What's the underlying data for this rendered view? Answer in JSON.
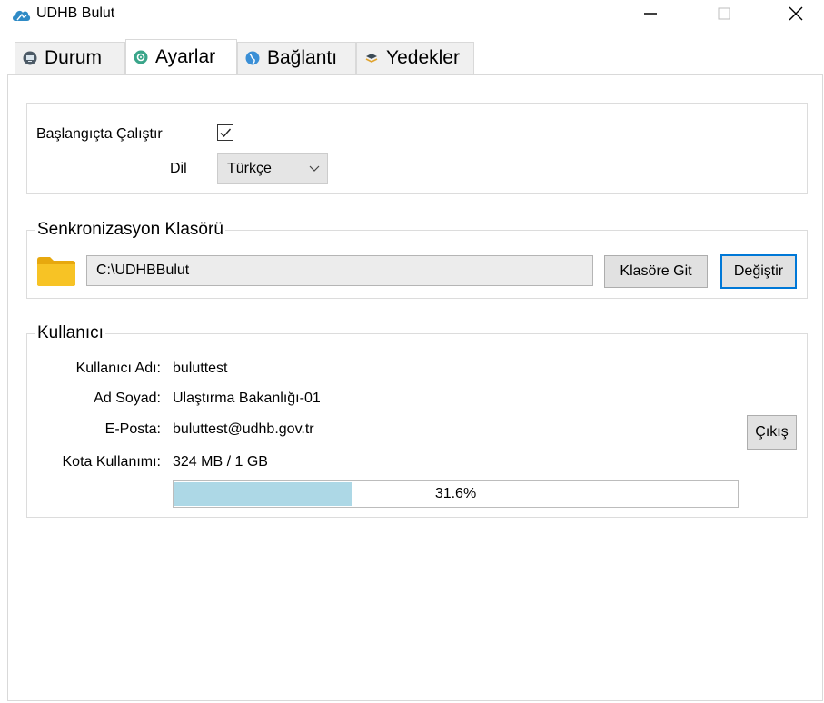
{
  "window": {
    "title": "UDHB Bulut",
    "icon": "cloud-icon",
    "brand_color": "#2f8bc6",
    "minimize_glyph": "—",
    "maximize_glyph": "☐",
    "close_glyph": "✕"
  },
  "tabs": [
    {
      "label": "Durum",
      "icon": "monitor-icon",
      "active": false
    },
    {
      "label": "Ayarlar",
      "icon": "gear-icon",
      "active": true
    },
    {
      "label": "Bağlantı",
      "icon": "globe-icon",
      "active": false
    },
    {
      "label": "Yedekler",
      "icon": "layers-icon",
      "active": false
    }
  ],
  "general": {
    "startup_label": "Başlangıçta Çalıştır",
    "startup_checked": true,
    "language_label": "Dil",
    "language_value": "Türkçe"
  },
  "sync": {
    "legend": "Senkronizasyon Klasörü",
    "folder_path": "C:\\UDHBBulut",
    "open_folder_label": "Klasöre Git",
    "change_label": "Değiştir"
  },
  "user": {
    "legend": "Kullanıcı",
    "username_label": "Kullanıcı Adı:",
    "username": "buluttest",
    "fullname_label": "Ad Soyad:",
    "fullname": "Ulaştırma Bakanlığı-01",
    "email_label": "E-Posta:",
    "email": "buluttest@udhb.gov.tr",
    "quota_label": "Kota Kullanımı:",
    "quota": "324 MB / 1 GB",
    "quota_percent_text": "31.6%",
    "quota_fraction": 0.316,
    "logout_label": "Çıkış"
  },
  "colors": {
    "progress_fill": "#add8e6",
    "focus_border": "#0078d7",
    "folder_yellow": "#f7c325"
  }
}
